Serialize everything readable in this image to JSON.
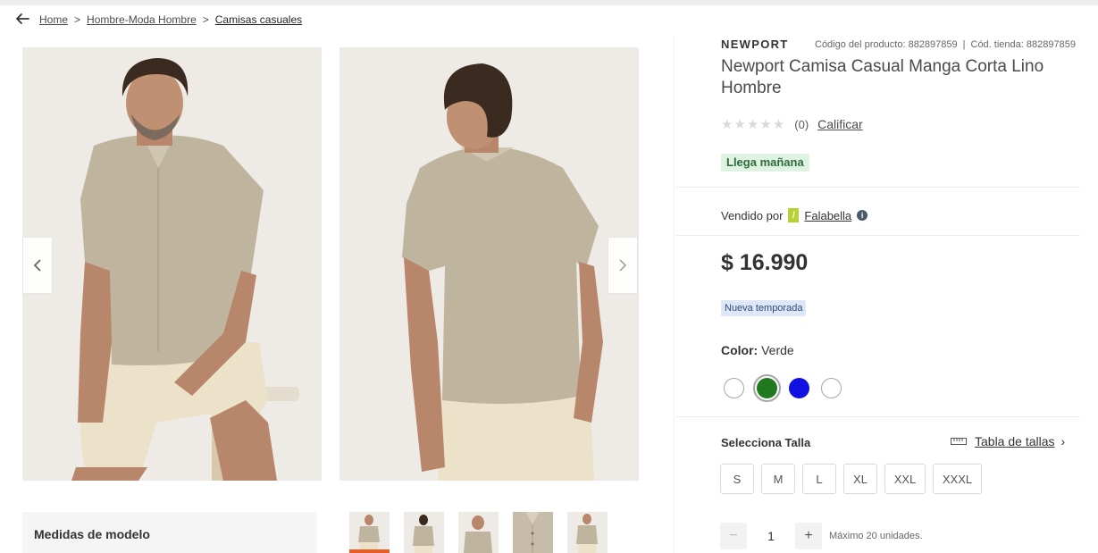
{
  "breadcrumb": {
    "items": [
      {
        "label": "Home"
      },
      {
        "label": "Hombre-Moda Hombre"
      },
      {
        "label": "Camisas casuales"
      }
    ],
    "separator": ">"
  },
  "gallery": {
    "prev_icon": "chevron-left-icon",
    "next_icon": "chevron-right-icon",
    "model_measures_label": "Medidas de modelo",
    "thumbnail_count": 5,
    "active_thumbnail": 1
  },
  "product": {
    "brand": "NEWPORT",
    "product_code": "Código del producto: 882897859",
    "store_code": "Cód. tienda: 882897859",
    "title": "Newport Camisa Casual Manga Corta Lino Hombre",
    "rating_value": 0,
    "rating_count": "(0)",
    "rate_link": "Calificar",
    "delivery_badge": "Llega mañana",
    "sold_by_label": "Vendido por",
    "seller_name": "Falabella",
    "seller_logo_glyph": "/",
    "price": "$ 16.990",
    "season_badge": "Nueva temporada",
    "color_label": "Color:",
    "color_value": "Verde",
    "swatches": [
      {
        "color": "#ffffff",
        "selected": false
      },
      {
        "color": "#1f7a1f",
        "selected": true
      },
      {
        "color": "#1010e0",
        "selected": false
      },
      {
        "color": "#ffffff",
        "selected": false
      }
    ],
    "size_label": "Selecciona Talla",
    "size_guide": "Tabla de tallas",
    "sizes": [
      "S",
      "M",
      "L",
      "XL",
      "XXL",
      "XXXL"
    ],
    "quantity": "1",
    "quantity_minus": "−",
    "quantity_plus": "+",
    "quantity_note": "Máximo 20 unidades."
  },
  "colors": {
    "delivery_badge_bg": "#dff3e3",
    "season_badge_bg": "#dde7f8",
    "active_thumb_underline": "#e85d25",
    "seller_logo_bg": "#b5d334"
  }
}
